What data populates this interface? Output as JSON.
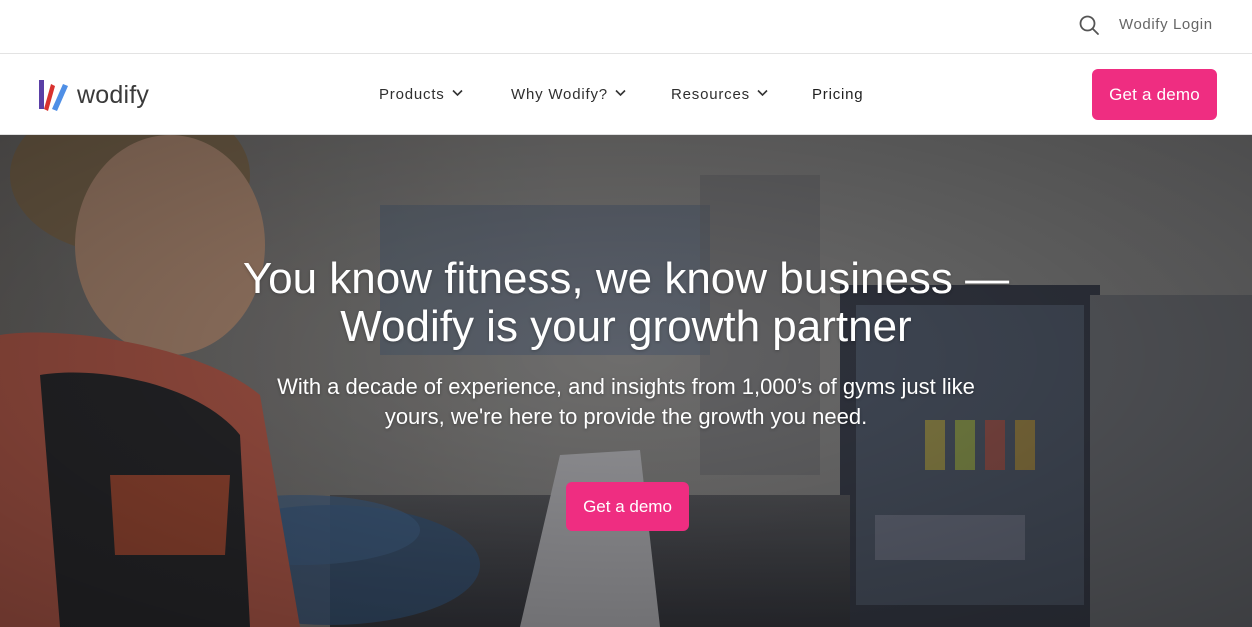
{
  "utility": {
    "search_icon": "search-icon",
    "login_label": "Wodify Login"
  },
  "nav": {
    "logo_text": "wodify",
    "items": [
      {
        "label": "Products",
        "has_dropdown": true
      },
      {
        "label": "Why Wodify?",
        "has_dropdown": true
      },
      {
        "label": "Resources",
        "has_dropdown": true
      },
      {
        "label": "Pricing",
        "has_dropdown": false
      }
    ],
    "cta_label": "Get a demo"
  },
  "hero": {
    "title": "You know fitness, we know business — Wodify is your growth partner",
    "subtitle": "With a decade of experience, and insights from 1,000’s of gyms just like yours, we're here to provide the growth you need.",
    "cta_label": "Get a demo"
  },
  "colors": {
    "accent": "#ef2d81",
    "logo_red": "#d8322f",
    "logo_purple": "#5a3fa6",
    "logo_blue": "#4f8fe6",
    "text_dark": "#2f2f2f",
    "text_muted": "#666666"
  }
}
